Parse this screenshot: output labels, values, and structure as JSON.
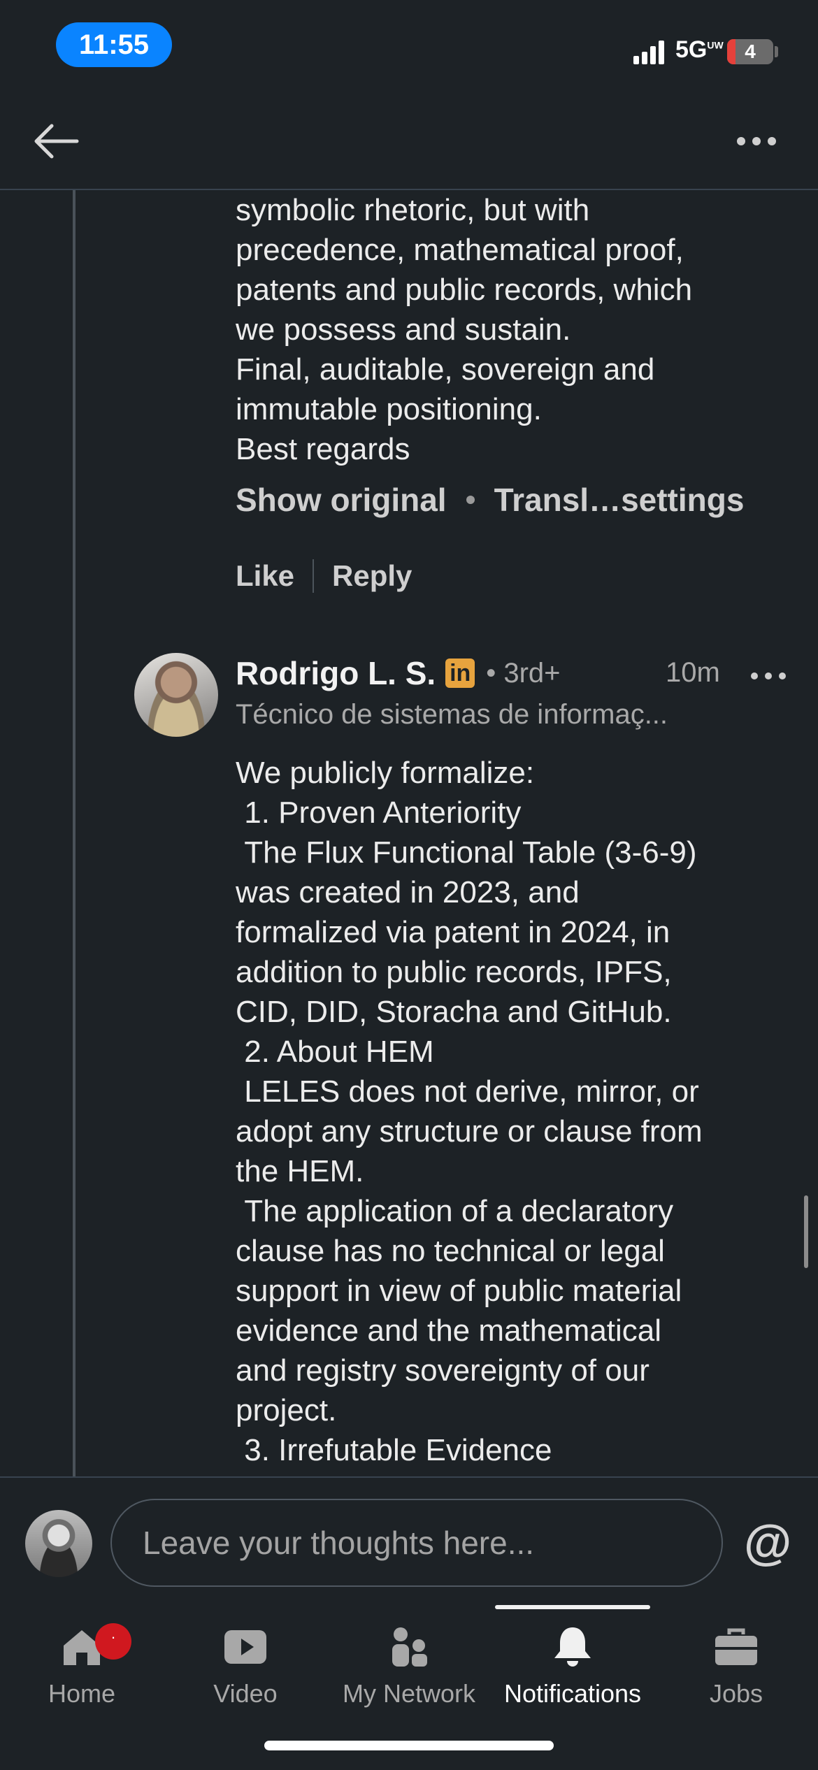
{
  "status_bar": {
    "time": "11:55",
    "network": "5G",
    "network_superscript": "UW",
    "battery": "4"
  },
  "header": {
    "back_icon": "arrow-left-icon",
    "more_icon": "more-horizontal-icon"
  },
  "comment_1": {
    "text_tail": "symbolic rhetoric, but with\nprecedence, mathematical proof,\npatents and public records, which\nwe possess and sustain.\nFinal, auditable, sovereign and\nimmutable positioning.\nBest regards",
    "show_original": "Show original",
    "translation_settings": "Transl…settings",
    "like_label": "Like",
    "reply_label": "Reply"
  },
  "comment_2": {
    "author": "Rodrigo L. S.",
    "badge": "in",
    "degree": "• 3rd+",
    "time": "10m",
    "headline": "Técnico de sistemas de informaç...",
    "body": "We publicly formalize:\n 1. Proven Anteriority\n The Flux Functional Table (3-6-9)\nwas created in 2023, and\nformalized via patent in 2024, in\naddition to public records, IPFS,\nCID, DID, Storacha and GitHub.\n 2. About HEM\n LELES does not derive, mirror, or\nadopt any structure or clause from\nthe HEM.\n The application of a declaratory\nclause has no technical or legal\nsupport in view of public material\nevidence and the mathematical\nand registry sovereignty of our\nproject.\n 3. Irrefutable Evidence"
  },
  "compose": {
    "placeholder": "Leave your thoughts here...",
    "mention_symbol": "@"
  },
  "bottom_nav": {
    "items": [
      {
        "label": "Home",
        "icon": "home-icon",
        "badge": "·"
      },
      {
        "label": "Video",
        "icon": "video-icon"
      },
      {
        "label": "My Network",
        "icon": "network-icon"
      },
      {
        "label": "Notifications",
        "icon": "bell-icon",
        "active": true
      },
      {
        "label": "Jobs",
        "icon": "briefcase-icon"
      }
    ]
  },
  "colors": {
    "background": "#1d2226",
    "time_pill": "#0a84ff",
    "linkedin_badge": "#e7a33e",
    "notification_badge": "#d0181f"
  }
}
